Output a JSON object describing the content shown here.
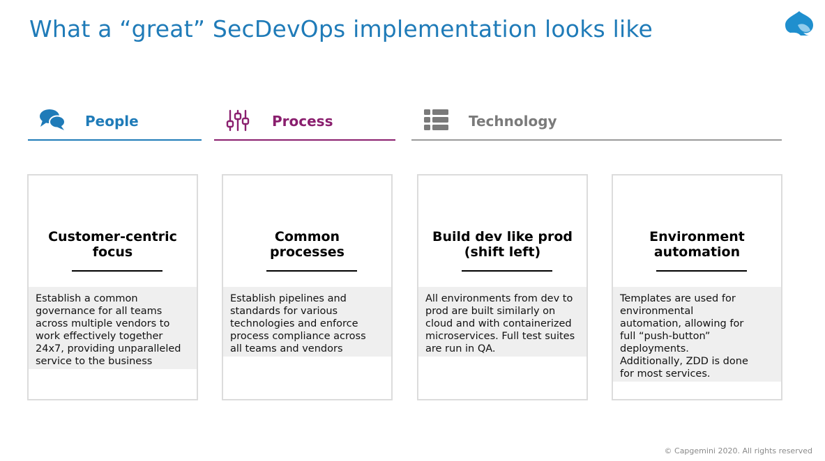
{
  "slide": {
    "title": "What a “great” SecDevOps implementation looks like",
    "copyright": "© Capgemini 2020. All rights reserved"
  },
  "colors": {
    "people": "#1f7bb8",
    "process": "#8a1f6e",
    "technology": "#7a7a7a"
  },
  "pillars": [
    {
      "label": "People",
      "icon": "chat-bubbles-icon"
    },
    {
      "label": "Process",
      "icon": "sliders-icon"
    },
    {
      "label": "Technology",
      "icon": "list-icon"
    }
  ],
  "cards": [
    {
      "title_line1": "Customer-centric",
      "title_line2": "focus",
      "description": [
        "Establish a common",
        "governance for all teams",
        "across multiple vendors to",
        "work effectively together",
        "24x7, providing unparalleled",
        "service to the business"
      ]
    },
    {
      "title_line1": "Common",
      "title_line2": "processes",
      "description": [
        "Establish pipelines and",
        "standards for various",
        "technologies and enforce",
        "process compliance across",
        "all teams and vendors"
      ]
    },
    {
      "title_line1": "Build dev like prod",
      "title_line2": "(shift left)",
      "description": [
        "All environments from dev to",
        "prod are built similarly on",
        "cloud and with containerized",
        "microservices. Full test suites",
        "are run in QA."
      ]
    },
    {
      "title_line1": "Environment",
      "title_line2": "automation",
      "description": [
        "Templates are used for",
        "environmental",
        "automation, allowing for",
        "full “push-button”",
        "deployments.",
        "Additionally, ZDD is done",
        "for most services."
      ]
    }
  ]
}
